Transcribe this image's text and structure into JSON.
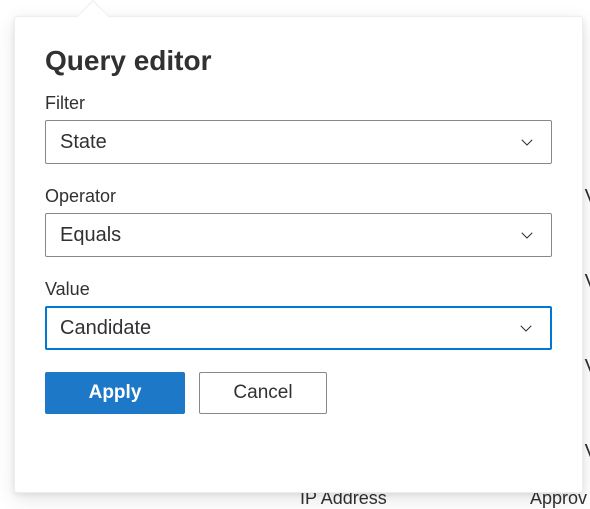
{
  "panel": {
    "title": "Query editor",
    "filter": {
      "label": "Filter",
      "value": "State"
    },
    "operator": {
      "label": "Operator",
      "value": "Equals"
    },
    "value": {
      "label": "Value",
      "value": "Candidate",
      "focused": true
    },
    "buttons": {
      "apply": "Apply",
      "cancel": "Cancel"
    }
  },
  "background": {
    "partial_right_1": "V",
    "partial_right_2": "V",
    "partial_right_3": "V",
    "partial_right_4": "V",
    "partial_bottom_1": "IP Address",
    "partial_bottom_2": "Approv"
  }
}
